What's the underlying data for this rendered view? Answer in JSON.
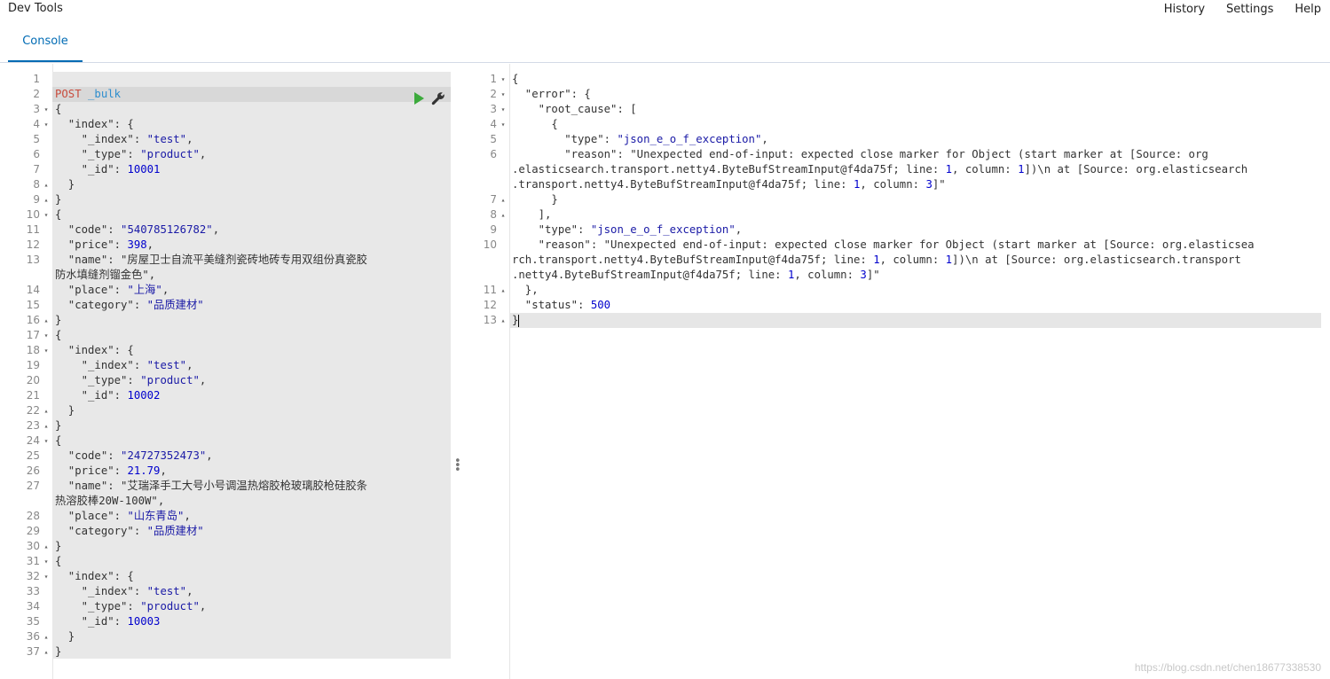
{
  "header": {
    "title": "Dev Tools",
    "menu": [
      "History",
      "Settings",
      "Help"
    ],
    "tab": "Console"
  },
  "request": {
    "lines": [
      {
        "n": "1",
        "f": "",
        "t": ""
      },
      {
        "n": "2",
        "f": "",
        "t": "POST _bulk",
        "method": "POST",
        "endpoint": "_bulk"
      },
      {
        "n": "3",
        "f": "▾",
        "t": "{"
      },
      {
        "n": "4",
        "f": "▾",
        "t": "  \"index\": {"
      },
      {
        "n": "5",
        "f": "",
        "t": "    \"_index\": \"test\","
      },
      {
        "n": "6",
        "f": "",
        "t": "    \"_type\": \"product\","
      },
      {
        "n": "7",
        "f": "",
        "t": "    \"_id\": 10001"
      },
      {
        "n": "8",
        "f": "▴",
        "t": "  }"
      },
      {
        "n": "9",
        "f": "▴",
        "t": "}"
      },
      {
        "n": "10",
        "f": "▾",
        "t": "{"
      },
      {
        "n": "11",
        "f": "",
        "t": "  \"code\": \"540785126782\","
      },
      {
        "n": "12",
        "f": "",
        "t": "  \"price\": 398,"
      },
      {
        "n": "13",
        "f": "",
        "t": "  \"name\": \"房屋卫士自流平美缝剂瓷砖地砖专用双组份真瓷胶"
      },
      {
        "n": "",
        "f": "",
        "t": "防水填缝剂镏金色\","
      },
      {
        "n": "14",
        "f": "",
        "t": "  \"place\": \"上海\","
      },
      {
        "n": "15",
        "f": "",
        "t": "  \"category\": \"品质建材\""
      },
      {
        "n": "16",
        "f": "▴",
        "t": "}"
      },
      {
        "n": "17",
        "f": "▾",
        "t": "{"
      },
      {
        "n": "18",
        "f": "▾",
        "t": "  \"index\": {"
      },
      {
        "n": "19",
        "f": "",
        "t": "    \"_index\": \"test\","
      },
      {
        "n": "20",
        "f": "",
        "t": "    \"_type\": \"product\","
      },
      {
        "n": "21",
        "f": "",
        "t": "    \"_id\": 10002"
      },
      {
        "n": "22",
        "f": "▴",
        "t": "  }"
      },
      {
        "n": "23",
        "f": "▴",
        "t": "}"
      },
      {
        "n": "24",
        "f": "▾",
        "t": "{"
      },
      {
        "n": "25",
        "f": "",
        "t": "  \"code\": \"24727352473\","
      },
      {
        "n": "26",
        "f": "",
        "t": "  \"price\": 21.79,"
      },
      {
        "n": "27",
        "f": "",
        "t": "  \"name\": \"艾瑞泽手工大号小号调温热熔胶枪玻璃胶枪硅胶条"
      },
      {
        "n": "",
        "f": "",
        "t": "热溶胶棒20W-100W\","
      },
      {
        "n": "28",
        "f": "",
        "t": "  \"place\": \"山东青岛\","
      },
      {
        "n": "29",
        "f": "",
        "t": "  \"category\": \"品质建材\""
      },
      {
        "n": "30",
        "f": "▴",
        "t": "}"
      },
      {
        "n": "31",
        "f": "▾",
        "t": "{"
      },
      {
        "n": "32",
        "f": "▾",
        "t": "  \"index\": {"
      },
      {
        "n": "33",
        "f": "",
        "t": "    \"_index\": \"test\","
      },
      {
        "n": "34",
        "f": "",
        "t": "    \"_type\": \"product\","
      },
      {
        "n": "35",
        "f": "",
        "t": "    \"_id\": 10003"
      },
      {
        "n": "36",
        "f": "▴",
        "t": "  }"
      },
      {
        "n": "37",
        "f": "▴",
        "t": "}"
      }
    ]
  },
  "response": {
    "lines": [
      {
        "n": "1",
        "f": "▾",
        "t": "{"
      },
      {
        "n": "2",
        "f": "▾",
        "t": "  \"error\": {"
      },
      {
        "n": "3",
        "f": "▾",
        "t": "    \"root_cause\": ["
      },
      {
        "n": "4",
        "f": "▾",
        "t": "      {"
      },
      {
        "n": "5",
        "f": "",
        "t": "        \"type\": \"json_e_o_f_exception\","
      },
      {
        "n": "6",
        "f": "",
        "t": "        \"reason\": \"Unexpected end-of-input: expected close marker for Object (start marker at [Source: org"
      },
      {
        "n": "",
        "f": "",
        "t": ".elasticsearch.transport.netty4.ByteBufStreamInput@f4da75f; line: 1, column: 1])\\n at [Source: org.elasticsearch"
      },
      {
        "n": "",
        "f": "",
        "t": ".transport.netty4.ByteBufStreamInput@f4da75f; line: 1, column: 3]\""
      },
      {
        "n": "7",
        "f": "▴",
        "t": "      }"
      },
      {
        "n": "8",
        "f": "▴",
        "t": "    ],"
      },
      {
        "n": "9",
        "f": "",
        "t": "    \"type\": \"json_e_o_f_exception\","
      },
      {
        "n": "10",
        "f": "",
        "t": "    \"reason\": \"Unexpected end-of-input: expected close marker for Object (start marker at [Source: org.elasticsea"
      },
      {
        "n": "",
        "f": "",
        "t": "rch.transport.netty4.ByteBufStreamInput@f4da75f; line: 1, column: 1])\\n at [Source: org.elasticsearch.transport"
      },
      {
        "n": "",
        "f": "",
        "t": ".netty4.ByteBufStreamInput@f4da75f; line: 1, column: 3]\""
      },
      {
        "n": "11",
        "f": "▴",
        "t": "  },"
      },
      {
        "n": "12",
        "f": "",
        "t": "  \"status\": 500"
      },
      {
        "n": "13",
        "f": "▴",
        "t": "}"
      }
    ]
  },
  "watermark": "https://blog.csdn.net/chen18677338530",
  "icons": {
    "run": "play-icon",
    "settings": "wrench-icon"
  },
  "colors": {
    "accent": "#006bb4",
    "run": "#3caa3c",
    "method": "#c84b3c",
    "endpoint": "#2e8ece",
    "string": "#1a1aa6",
    "number": "#0000cd"
  }
}
